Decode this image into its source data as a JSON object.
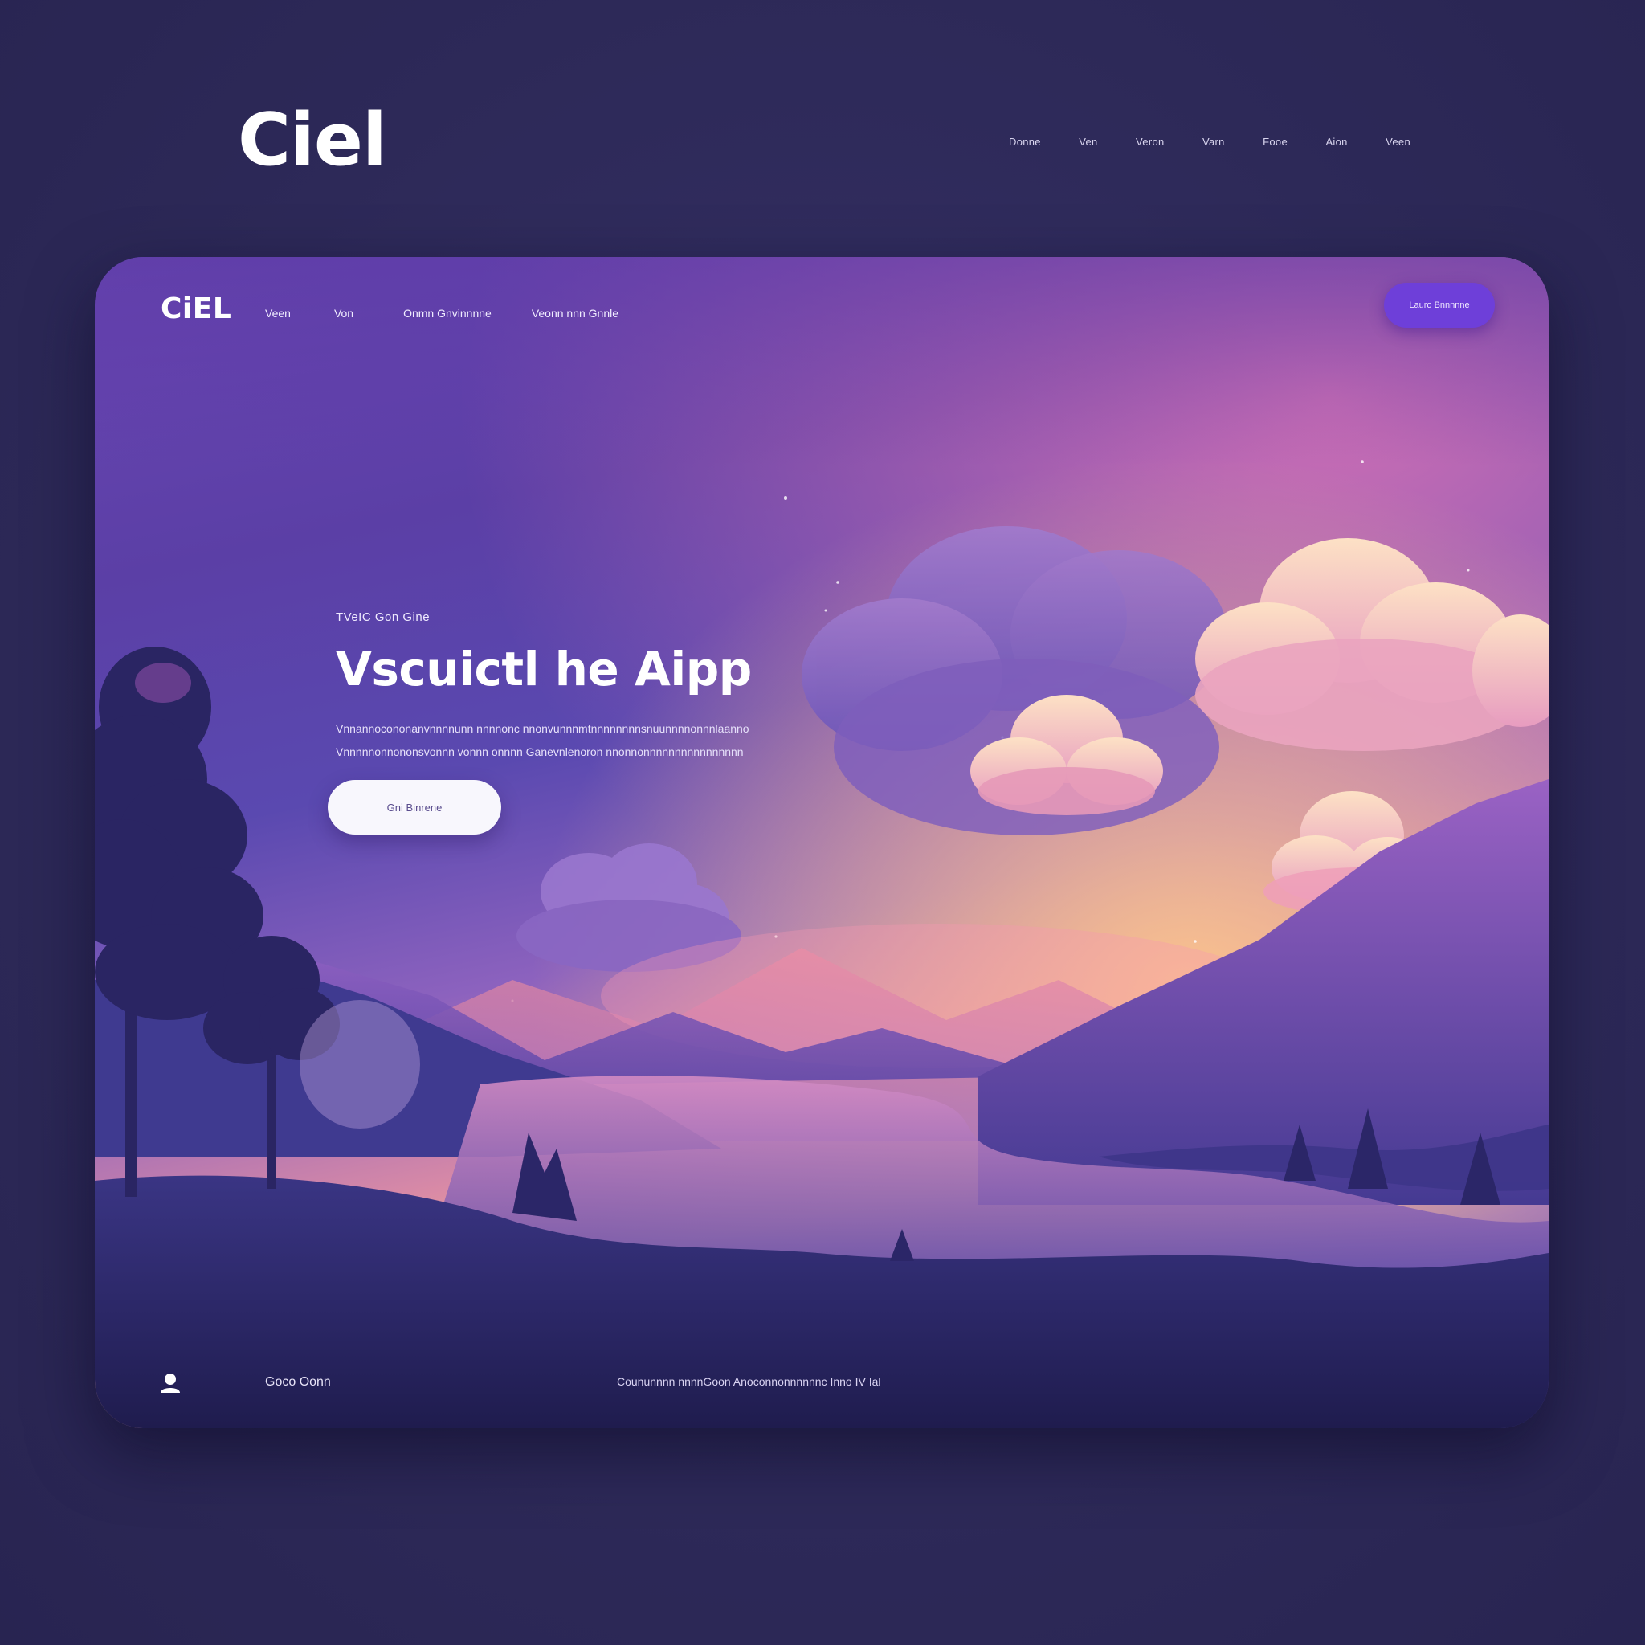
{
  "outer": {
    "logo": "Ciel",
    "nav": [
      "Donne",
      "Ven",
      "Veron",
      "Varn",
      "Fooe",
      "Aion",
      "Veen"
    ]
  },
  "card": {
    "logo": "CiEL",
    "nav": [
      "Veen",
      "Von",
      "Onmn Gnvinnnne",
      "Veonn nnn Gnnle"
    ],
    "cta_label": "Lauro Bnnnnne",
    "hero": {
      "eyebrow": "TVeIC Gon Gine",
      "title": "Vscuictl he Aipp",
      "description": "Vnnannocononanvnnnnunn nnnnonc nnonvunnnmtnnnnnnnnsnuunnnnonnnlaanno Vnnnnnonnononsvonnn vonnn onnnn Ganevnlenoron nnonnonnnnnnnnnnnnnnnn",
      "button_label": "Gni Binrene"
    },
    "footer": {
      "left_text": "Goco Oonn",
      "center_text": "Coununnnn nnnnGoon Anoconnonnnnnnc Inno IV Ial"
    }
  },
  "colors": {
    "page_background": "#2f2b5c",
    "cta_purple": "#6e3fd9",
    "hero_button": "#f8f7fd"
  }
}
